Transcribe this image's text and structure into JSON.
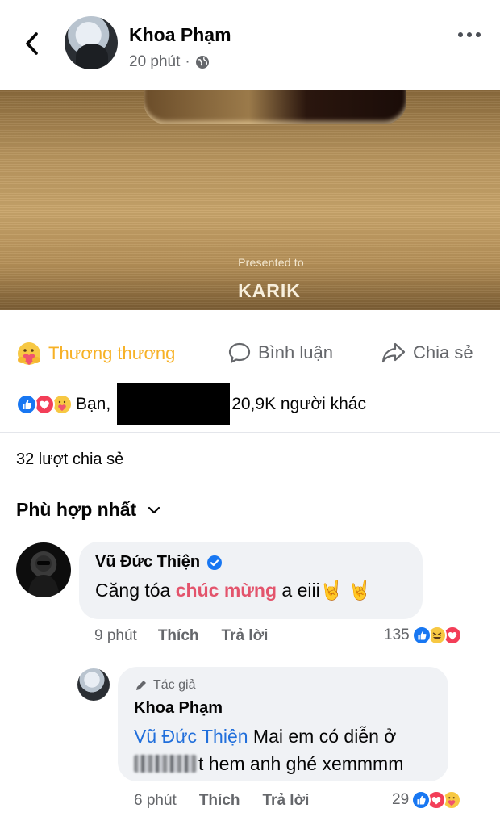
{
  "header": {
    "author_name": "Khoa Phạm",
    "time": "20 phút",
    "separator": "·",
    "icons": {
      "back": "chevron-left-icon",
      "privacy": "globe-icon",
      "more": "more-horizontal-icon"
    }
  },
  "photo": {
    "presented_to": "Presented to",
    "name": "KARIK"
  },
  "actions": {
    "react_label": "Thương thương",
    "comment_label": "Bình luận",
    "share_label": "Chia sẻ",
    "react_color": "#f7b125"
  },
  "reactions": {
    "prefix": "Bạn,",
    "others": "20,9K người khác",
    "types": [
      "like",
      "love",
      "care"
    ]
  },
  "shares": {
    "label": "32 lượt chia sẻ"
  },
  "sort": {
    "label": "Phù hợp nhất"
  },
  "comments": [
    {
      "name": "Vũ Đức Thiện",
      "verified": true,
      "text_before": "Căng tóa ",
      "highlight": "chúc mừng",
      "text_after": " a eiii",
      "emoji": "🤘 🤘",
      "time": "9 phút",
      "like_label": "Thích",
      "reply_label": "Trả lời",
      "reaction_count": "135",
      "reaction_types": [
        "like",
        "haha",
        "love"
      ]
    }
  ],
  "reply": {
    "badge": "Tác giả",
    "name": "Khoa Phạm",
    "mention": "Vũ Đức Thiện",
    "text_line1": " Mai em có diễn ở",
    "text_line2": "t hem anh ghé xemmmm",
    "time": "6 phút",
    "like_label": "Thích",
    "reply_label": "Trả lời",
    "reaction_count": "29",
    "reaction_types": [
      "like",
      "love",
      "care"
    ]
  },
  "colors": {
    "link_blue": "#216fdb",
    "highlight_pink": "#e3546c",
    "like_blue": "#1877f2",
    "love_red": "#f33e58",
    "care_yellow": "#f7b125"
  }
}
